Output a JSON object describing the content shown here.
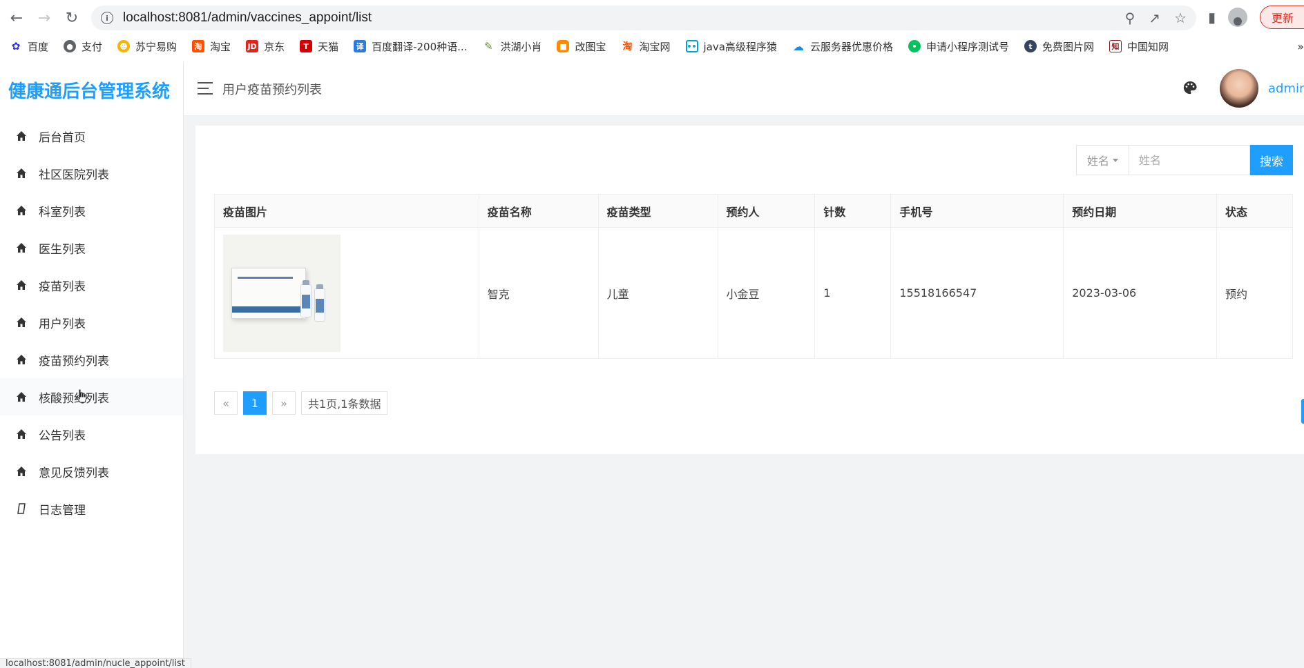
{
  "browser": {
    "url": "localhost:8081/admin/vaccines_appoint/list",
    "update_label": "更新",
    "status_url": "localhost:8081/admin/nucle_appoint/list"
  },
  "bookmarks": [
    {
      "label": "百度",
      "icon": "baidu-paw-icon",
      "color": "#2932e1"
    },
    {
      "label": "支付",
      "icon": "globe-icon",
      "color": "#5f6368"
    },
    {
      "label": "苏宁易购",
      "icon": "suning-icon",
      "color": "#f7b500"
    },
    {
      "label": "淘宝",
      "icon": "taobao-icon",
      "color": "#ff5000"
    },
    {
      "label": "京东",
      "icon": "jd-icon",
      "color": "#e1251b"
    },
    {
      "label": "天猫",
      "icon": "tmall-icon",
      "color": "#d20000"
    },
    {
      "label": "百度翻译-200种语...",
      "icon": "translate-icon",
      "color": "#2a7be4"
    },
    {
      "label": "洪湖小肖",
      "icon": "pen-icon",
      "color": "#6a8a3a"
    },
    {
      "label": "改图宝",
      "icon": "gaitubao-icon",
      "color": "#ff8a00"
    },
    {
      "label": "淘宝网",
      "icon": "taobao-icon",
      "color": "#ff5000"
    },
    {
      "label": "java高级程序猿",
      "icon": "bilibili-icon",
      "color": "#00a1d6"
    },
    {
      "label": "云服务器优惠价格",
      "icon": "cloud-icon",
      "color": "#1e88e5"
    },
    {
      "label": "申请小程序测试号",
      "icon": "wechat-icon",
      "color": "#07c160"
    },
    {
      "label": "免费图片网",
      "icon": "tumblr-icon",
      "color": "#35465c"
    },
    {
      "label": "中国知网",
      "icon": "cnki-icon",
      "color": "#8b1a1a"
    }
  ],
  "sidebar": {
    "logo": "健康通后台管理系统",
    "items": [
      {
        "label": "后台首页",
        "icon": "home-icon"
      },
      {
        "label": "社区医院列表",
        "icon": "home-icon"
      },
      {
        "label": "科室列表",
        "icon": "home-icon"
      },
      {
        "label": "医生列表",
        "icon": "home-icon"
      },
      {
        "label": "疫苗列表",
        "icon": "home-icon"
      },
      {
        "label": "用户列表",
        "icon": "home-icon"
      },
      {
        "label": "疫苗预约列表",
        "icon": "home-icon"
      },
      {
        "label": "核酸预约列表",
        "icon": "home-icon"
      },
      {
        "label": "公告列表",
        "icon": "home-icon"
      },
      {
        "label": "意见反馈列表",
        "icon": "home-icon"
      },
      {
        "label": "日志管理",
        "icon": "log-icon"
      }
    ]
  },
  "header": {
    "title": "用户疫苗预约列表",
    "username": "admin"
  },
  "search": {
    "field_select": "姓名",
    "placeholder": "姓名",
    "button": "搜索"
  },
  "table": {
    "columns": [
      "疫苗图片",
      "疫苗名称",
      "疫苗类型",
      "预约人",
      "针数",
      "手机号",
      "预约日期",
      "状态"
    ],
    "rows": [
      {
        "image": "vaccine-box-image",
        "name": "智克",
        "type": "儿童",
        "person": "小金豆",
        "doses": "1",
        "phone": "15518166547",
        "date": "2023-03-06",
        "status": "预约"
      }
    ]
  },
  "pagination": {
    "prev": "«",
    "page": "1",
    "next": "»",
    "info": "共1页,1条数据"
  },
  "colors": {
    "accent": "#1e9fff",
    "status_green": "#3cb371"
  }
}
